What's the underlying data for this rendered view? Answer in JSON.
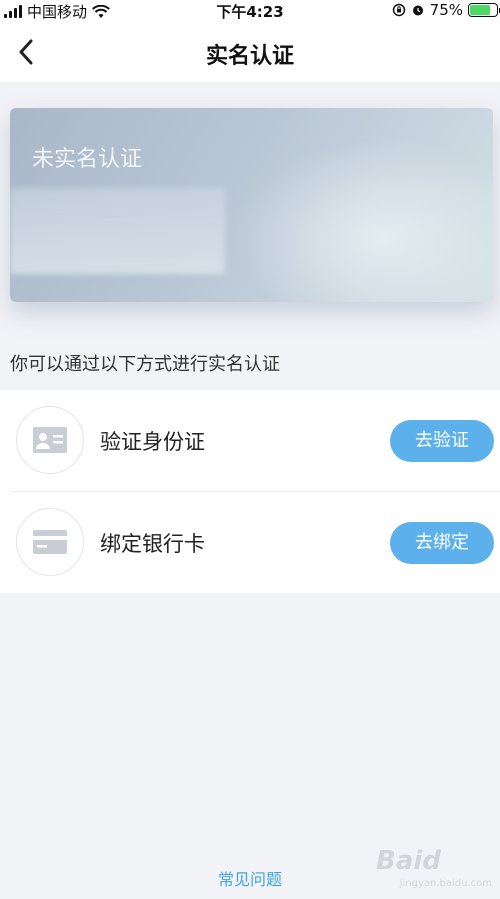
{
  "status_bar": {
    "carrier": "中国移动",
    "time": "下午4:23",
    "battery_percent": "75%",
    "battery_level": 0.75
  },
  "nav": {
    "back_icon": "chevron-left-icon",
    "title": "实名认证"
  },
  "card": {
    "status_text": "未实名认证"
  },
  "hint": "你可以通过以下方式进行实名认证",
  "methods": [
    {
      "icon": "id-card-icon",
      "label": "验证身份证",
      "action": "去验证"
    },
    {
      "icon": "bank-card-icon",
      "label": "绑定银行卡",
      "action": "去绑定"
    }
  ],
  "footer": {
    "faq_label": "常见问题"
  },
  "watermark": {
    "text": "Baid",
    "sub": "jingyan.baidu.com"
  },
  "colors": {
    "accent": "#5cb1ec",
    "link": "#3fa3e5",
    "background": "#f2f3f7",
    "battery": "#4cd964"
  }
}
